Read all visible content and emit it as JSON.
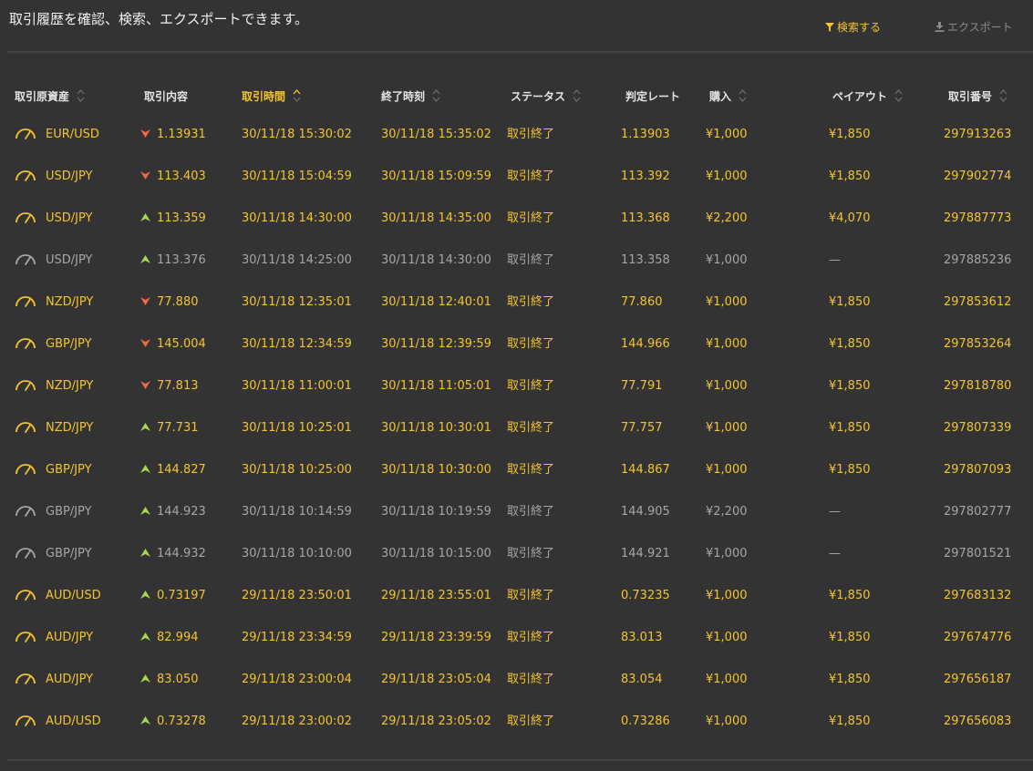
{
  "page": {
    "description": "取引履歴を確認、検索、エクスポートできます。",
    "search_label": "検索する",
    "export_label": "エクスポート"
  },
  "colors": {
    "accent": "#f4c430",
    "muted": "#a6a6a6",
    "up": "#a8d94f",
    "down": "#ef6a47",
    "background": "#333333"
  },
  "table": {
    "columns": [
      "取引原資産",
      "取引内容",
      "取引時間",
      "終了時刻",
      "ステータス",
      "判定レート",
      "購入",
      "ペイアウト",
      "取引番号"
    ],
    "rows": [
      {
        "asset": "EUR/USD",
        "direction": "down",
        "price": "1.13931",
        "open": "30/11/18 15:30:02",
        "close": "30/11/18 15:35:02",
        "status": "取引終了",
        "rate": "1.13903",
        "buy": "¥1,000",
        "payout": "¥1,850",
        "id": "297913263",
        "win": true
      },
      {
        "asset": "USD/JPY",
        "direction": "down",
        "price": "113.403",
        "open": "30/11/18 15:04:59",
        "close": "30/11/18 15:09:59",
        "status": "取引終了",
        "rate": "113.392",
        "buy": "¥1,000",
        "payout": "¥1,850",
        "id": "297902774",
        "win": true
      },
      {
        "asset": "USD/JPY",
        "direction": "up",
        "price": "113.359",
        "open": "30/11/18 14:30:00",
        "close": "30/11/18 14:35:00",
        "status": "取引終了",
        "rate": "113.368",
        "buy": "¥2,200",
        "payout": "¥4,070",
        "id": "297887773",
        "win": true
      },
      {
        "asset": "USD/JPY",
        "direction": "up",
        "price": "113.376",
        "open": "30/11/18 14:25:00",
        "close": "30/11/18 14:30:00",
        "status": "取引終了",
        "rate": "113.358",
        "buy": "¥1,000",
        "payout": "—",
        "id": "297885236",
        "win": false
      },
      {
        "asset": "NZD/JPY",
        "direction": "down",
        "price": "77.880",
        "open": "30/11/18 12:35:01",
        "close": "30/11/18 12:40:01",
        "status": "取引終了",
        "rate": "77.860",
        "buy": "¥1,000",
        "payout": "¥1,850",
        "id": "297853612",
        "win": true
      },
      {
        "asset": "GBP/JPY",
        "direction": "down",
        "price": "145.004",
        "open": "30/11/18 12:34:59",
        "close": "30/11/18 12:39:59",
        "status": "取引終了",
        "rate": "144.966",
        "buy": "¥1,000",
        "payout": "¥1,850",
        "id": "297853264",
        "win": true
      },
      {
        "asset": "NZD/JPY",
        "direction": "down",
        "price": "77.813",
        "open": "30/11/18 11:00:01",
        "close": "30/11/18 11:05:01",
        "status": "取引終了",
        "rate": "77.791",
        "buy": "¥1,000",
        "payout": "¥1,850",
        "id": "297818780",
        "win": true
      },
      {
        "asset": "NZD/JPY",
        "direction": "up",
        "price": "77.731",
        "open": "30/11/18 10:25:01",
        "close": "30/11/18 10:30:01",
        "status": "取引終了",
        "rate": "77.757",
        "buy": "¥1,000",
        "payout": "¥1,850",
        "id": "297807339",
        "win": true
      },
      {
        "asset": "GBP/JPY",
        "direction": "up",
        "price": "144.827",
        "open": "30/11/18 10:25:00",
        "close": "30/11/18 10:30:00",
        "status": "取引終了",
        "rate": "144.867",
        "buy": "¥1,000",
        "payout": "¥1,850",
        "id": "297807093",
        "win": true
      },
      {
        "asset": "GBP/JPY",
        "direction": "up",
        "price": "144.923",
        "open": "30/11/18 10:14:59",
        "close": "30/11/18 10:19:59",
        "status": "取引終了",
        "rate": "144.905",
        "buy": "¥2,200",
        "payout": "—",
        "id": "297802777",
        "win": false
      },
      {
        "asset": "GBP/JPY",
        "direction": "up",
        "price": "144.932",
        "open": "30/11/18 10:10:00",
        "close": "30/11/18 10:15:00",
        "status": "取引終了",
        "rate": "144.921",
        "buy": "¥1,000",
        "payout": "—",
        "id": "297801521",
        "win": false
      },
      {
        "asset": "AUD/USD",
        "direction": "up",
        "price": "0.73197",
        "open": "29/11/18 23:50:01",
        "close": "29/11/18 23:55:01",
        "status": "取引終了",
        "rate": "0.73235",
        "buy": "¥1,000",
        "payout": "¥1,850",
        "id": "297683132",
        "win": true
      },
      {
        "asset": "AUD/JPY",
        "direction": "up",
        "price": "82.994",
        "open": "29/11/18 23:34:59",
        "close": "29/11/18 23:39:59",
        "status": "取引終了",
        "rate": "83.013",
        "buy": "¥1,000",
        "payout": "¥1,850",
        "id": "297674776",
        "win": true
      },
      {
        "asset": "AUD/JPY",
        "direction": "up",
        "price": "83.050",
        "open": "29/11/18 23:00:04",
        "close": "29/11/18 23:05:04",
        "status": "取引終了",
        "rate": "83.054",
        "buy": "¥1,000",
        "payout": "¥1,850",
        "id": "297656187",
        "win": true
      },
      {
        "asset": "AUD/USD",
        "direction": "up",
        "price": "0.73278",
        "open": "29/11/18 23:00:02",
        "close": "29/11/18 23:05:02",
        "status": "取引終了",
        "rate": "0.73286",
        "buy": "¥1,000",
        "payout": "¥1,850",
        "id": "297656083",
        "win": true
      }
    ]
  }
}
